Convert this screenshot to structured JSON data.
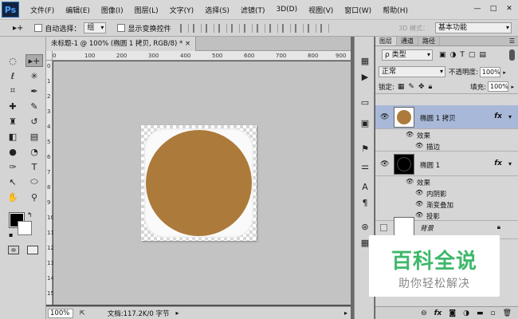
{
  "app": {
    "logo": "Ps"
  },
  "menu": [
    "文件(F)",
    "编辑(E)",
    "图像(I)",
    "图层(L)",
    "文字(Y)",
    "选择(S)",
    "滤镜(T)",
    "3D(D)",
    "视图(V)",
    "窗口(W)",
    "帮助(H)"
  ],
  "window_controls": [
    "—",
    "□",
    "✕"
  ],
  "options_bar": {
    "auto_select_label": "自动选择：",
    "auto_select_value": "组",
    "show_transform_label": "显示变换控件",
    "workspace_label": "3D 模式：",
    "workspace_value": "基本功能"
  },
  "document": {
    "tab_title": "未标题-1 @ 100% (椭圆 1 拷贝, RGB/8) * ×",
    "zoom": "100%",
    "doc_info": "文档:117.2K/0 字节",
    "ruler_h_ticks": [
      "0",
      "100",
      "200",
      "300",
      "400",
      "500",
      "600",
      "700",
      "800",
      "900"
    ],
    "ruler_v_ticks": [
      "0",
      "1",
      "2",
      "3",
      "4",
      "5",
      "6",
      "7",
      "8",
      "9",
      "10",
      "11",
      "12",
      "13",
      "14",
      "15"
    ],
    "shape_color": "#ac7a3a"
  },
  "layers_panel": {
    "tabs": [
      "图层",
      "通道",
      "路径"
    ],
    "filter_select": "ρ 类型",
    "blend_mode": "正常",
    "opacity_label": "不透明度:",
    "opacity_value": "100%",
    "lock_label": "锁定:",
    "fill_label": "填充:",
    "fill_value": "100%",
    "layers": [
      {
        "name": "椭圆 1 拷贝",
        "fx": "fx",
        "effects_label": "效果",
        "effects": [
          "描边"
        ]
      },
      {
        "name": "椭圆 1",
        "fx": "fx",
        "effects_label": "效果",
        "effects": [
          "内阴影",
          "渐变叠加",
          "投影"
        ]
      },
      {
        "name": "背景"
      }
    ],
    "bottom_icons": [
      "link-icon",
      "fx-icon",
      "mask-icon",
      "adjustment-icon",
      "folder-icon",
      "new-layer-icon",
      "trash-icon"
    ]
  },
  "watermark": {
    "title": "百科全说",
    "subtitle": "助你轻松解决"
  }
}
